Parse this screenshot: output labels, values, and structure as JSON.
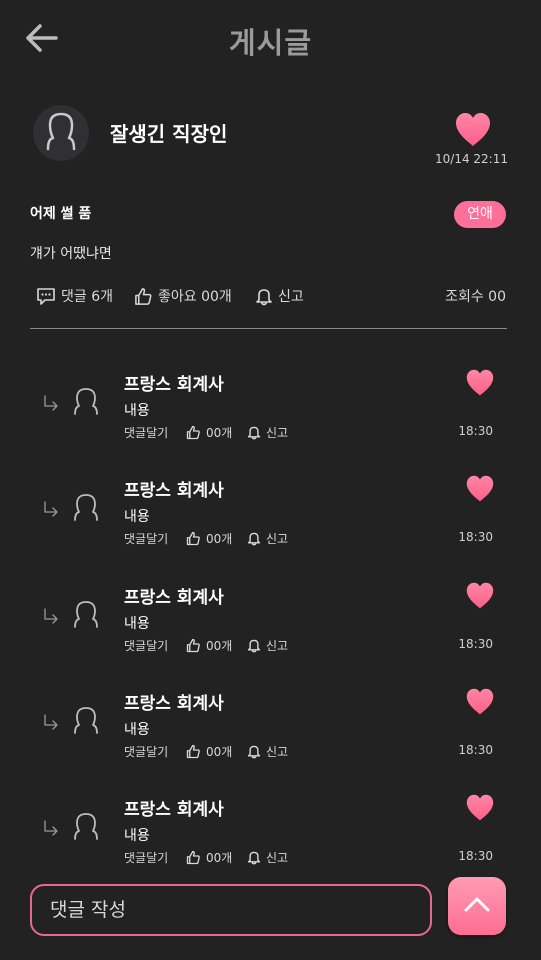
{
  "header": {
    "title": "게시글"
  },
  "post": {
    "author": "잘생긴 직장인",
    "time": "10/14 22:11",
    "title": "어제 썰 품",
    "category": "연애",
    "body": "걔가 어땠냐면",
    "comments_label": "댓글 6개",
    "likes_label": "좋아요 00개",
    "report_label": "신고",
    "views_label": "조회수 00"
  },
  "comments": [
    {
      "name": "프랑스 회계사",
      "body": "내용",
      "reply_label": "댓글달기",
      "likes": "00개",
      "report": "신고",
      "time": "18:30"
    },
    {
      "name": "프랑스 회계사",
      "body": "내용",
      "reply_label": "댓글달기",
      "likes": "00개",
      "report": "신고",
      "time": "18:30"
    },
    {
      "name": "프랑스 회계사",
      "body": "내용",
      "reply_label": "댓글달기",
      "likes": "00개",
      "report": "신고",
      "time": "18:30"
    },
    {
      "name": "프랑스 회계사",
      "body": "내용",
      "reply_label": "댓글달기",
      "likes": "00개",
      "report": "신고",
      "time": "18:30"
    },
    {
      "name": "프랑스 회계사",
      "body": "내용",
      "reply_label": "댓글달기",
      "likes": "00개",
      "report": "신고",
      "time": "18:30"
    }
  ],
  "composer": {
    "placeholder": "댓글 작성"
  },
  "colors": {
    "background": "#222222",
    "accent": "#ff6f9a",
    "heart": "#ff7096"
  }
}
